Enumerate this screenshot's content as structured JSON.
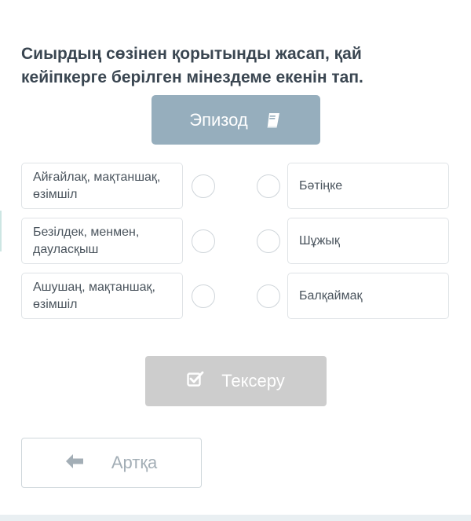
{
  "question": "Сиырдың сөзінен қорытынды жасап, қай кейіпкерге берілген мінездеме екенін тап.",
  "episode_button": {
    "label": "Эпизод",
    "icon": "book-icon"
  },
  "left_options": [
    {
      "text": "Айғайлақ, мақтаншақ, өзімшіл"
    },
    {
      "text": "Безілдек, менмен, дауласқыш"
    },
    {
      "text": "Ашушаң, мақтаншақ, өзімшіл"
    }
  ],
  "right_options": [
    {
      "text": "Бәтіңке"
    },
    {
      "text": "Шұжық"
    },
    {
      "text": "Балқаймақ"
    }
  ],
  "check_button": {
    "label": "Тексеру",
    "icon": "checkbox-icon"
  },
  "back_button": {
    "label": "Артқа",
    "icon": "arrow-left-icon"
  },
  "colors": {
    "episode_bg": "#96aebd",
    "check_bg": "#cdcdcd",
    "text": "#3a4651",
    "border": "#dfe3e6"
  }
}
